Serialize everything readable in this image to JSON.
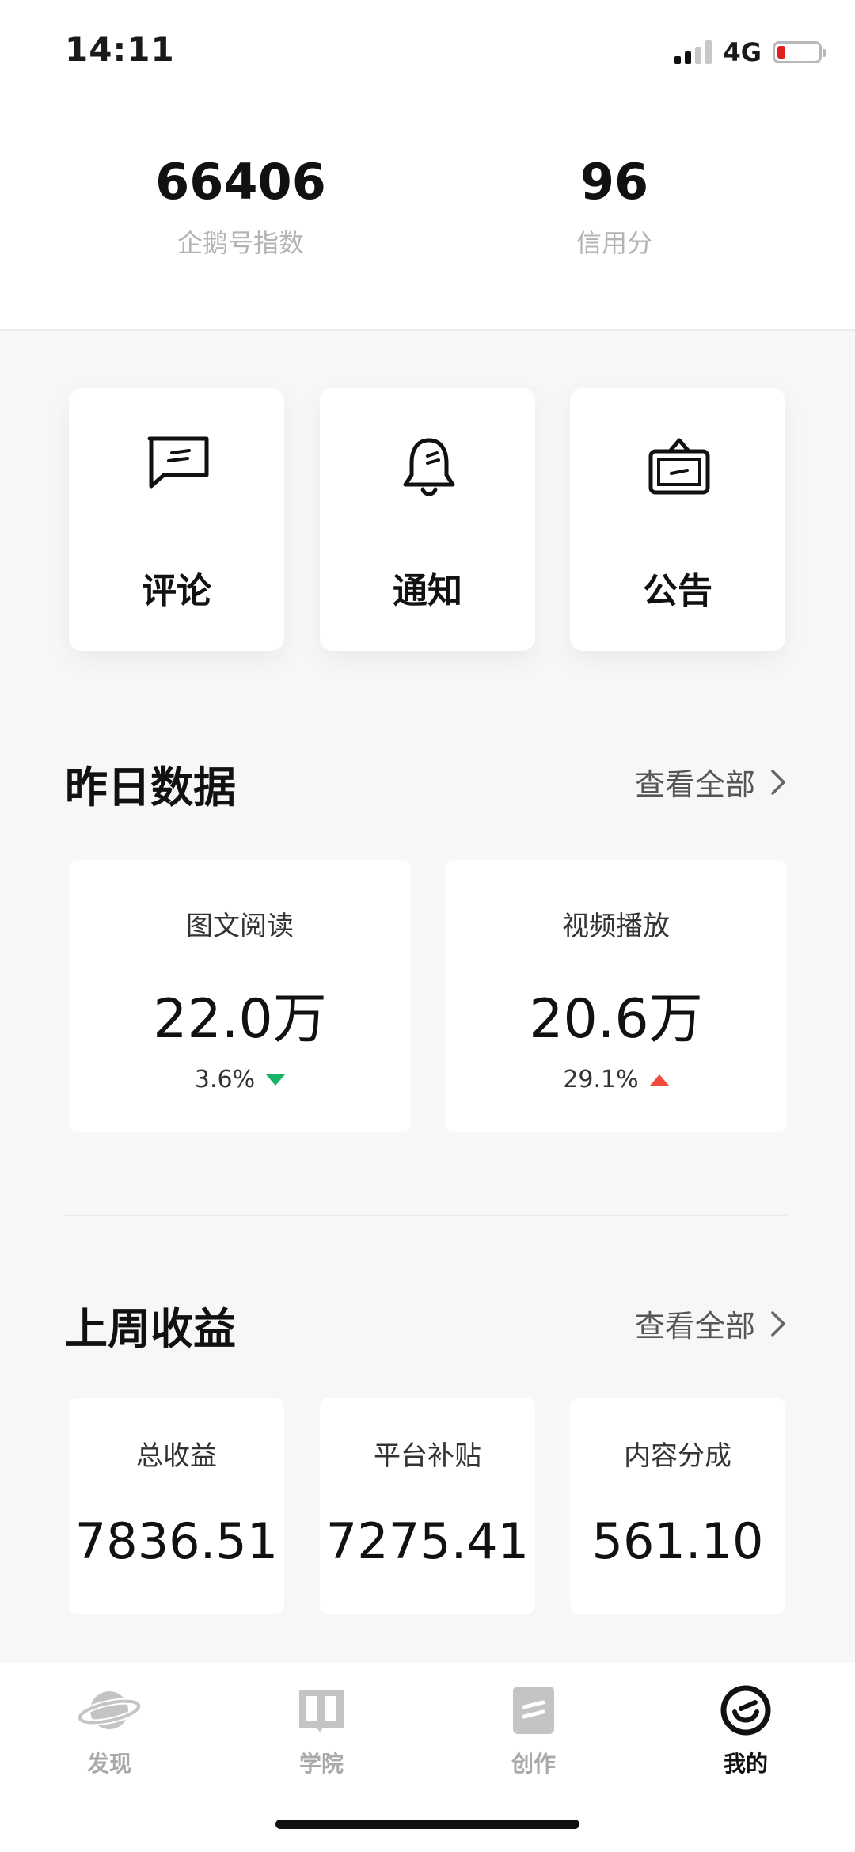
{
  "status": {
    "time": "14:11",
    "network": "4G"
  },
  "stats": [
    {
      "value": "66406",
      "label": "企鹅号指数"
    },
    {
      "value": "96",
      "label": "信用分"
    }
  ],
  "quick_actions": [
    {
      "label": "评论",
      "icon": "comment-icon"
    },
    {
      "label": "通知",
      "icon": "bell-icon"
    },
    {
      "label": "公告",
      "icon": "announcement-icon"
    }
  ],
  "yesterday": {
    "title": "昨日数据",
    "see_all": "查看全部",
    "cards": [
      {
        "label": "图文阅读",
        "value": "22.0万",
        "change": "3.6%",
        "trend": "down",
        "trend_color": "#18b566"
      },
      {
        "label": "视频播放",
        "value": "20.6万",
        "change": "29.1%",
        "trend": "up",
        "trend_color": "#f04c3b"
      }
    ]
  },
  "last_week": {
    "title": "上周收益",
    "see_all": "查看全部",
    "cards": [
      {
        "label": "总收益",
        "value": "7836.51"
      },
      {
        "label": "平台补贴",
        "value": "7275.41"
      },
      {
        "label": "内容分成",
        "value": "561.10"
      }
    ]
  },
  "tabs": [
    {
      "label": "发现",
      "icon": "planet-icon",
      "active": false
    },
    {
      "label": "学院",
      "icon": "book-icon",
      "active": false
    },
    {
      "label": "创作",
      "icon": "edit-icon",
      "active": false
    },
    {
      "label": "我的",
      "icon": "profile-icon",
      "active": true
    }
  ]
}
